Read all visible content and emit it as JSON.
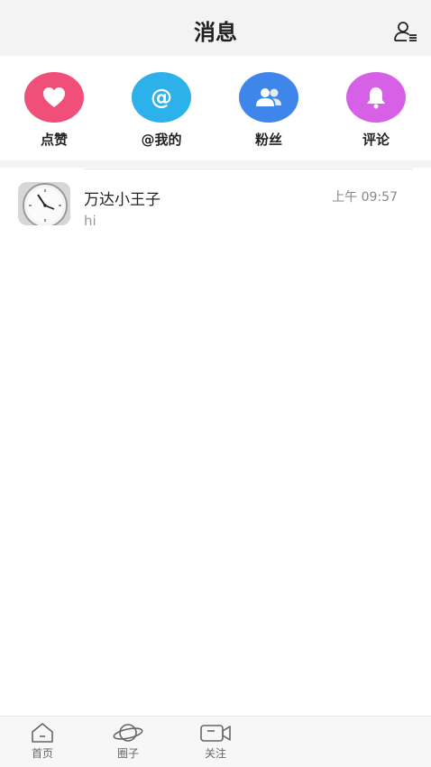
{
  "header": {
    "title": "消息",
    "contacts_icon": "contacts-icon"
  },
  "shortcuts": [
    {
      "label": "点赞",
      "icon": "heart-icon",
      "color": "#ef4f79"
    },
    {
      "label": "@我的",
      "icon": "at-icon",
      "color": "#2db1ea"
    },
    {
      "label": "粉丝",
      "icon": "users-icon",
      "color": "#3f86eb"
    },
    {
      "label": "评论",
      "icon": "bell-icon",
      "color": "#d661e6"
    }
  ],
  "messages": [
    {
      "name": "万达小王子",
      "time": "上午 09:57",
      "preview": "hi",
      "avatar": "clock-avatar"
    }
  ],
  "bottom_nav": [
    {
      "label": "首页",
      "icon": "home-icon"
    },
    {
      "label": "圈子",
      "icon": "planet-icon"
    },
    {
      "label": "关注",
      "icon": "video-camera-icon"
    }
  ]
}
